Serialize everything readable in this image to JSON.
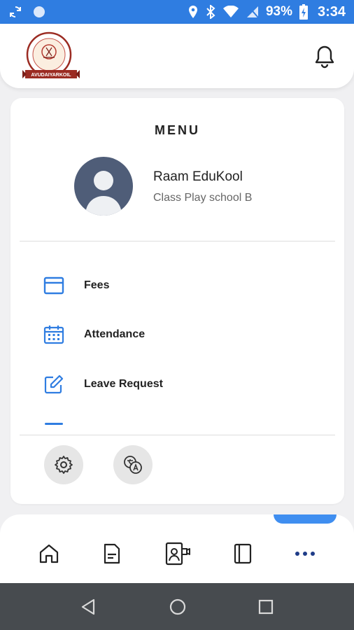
{
  "status_bar": {
    "battery": "93%",
    "time": "3:34"
  },
  "header": {
    "logo_text": "AVUDAIYARKOIL",
    "logo_icon": "school-crest-logo",
    "bell_icon": "bell-icon"
  },
  "menu": {
    "title": "MENU",
    "user": {
      "name": "Raam EduKool",
      "class_name": "Class Play school B"
    },
    "items": [
      {
        "label": "Fees",
        "icon": "credit-card-icon"
      },
      {
        "label": "Attendance",
        "icon": "calendar-icon"
      },
      {
        "label": "Leave Request",
        "icon": "edit-icon"
      }
    ],
    "footer_buttons": [
      {
        "icon": "settings-gear-icon"
      },
      {
        "icon": "translate-icon"
      }
    ]
  },
  "bottom_nav": {
    "items": [
      {
        "icon": "home-icon"
      },
      {
        "icon": "document-icon"
      },
      {
        "icon": "video-contact-icon"
      },
      {
        "icon": "notebook-icon"
      },
      {
        "icon": "more-dots-icon"
      }
    ],
    "active_index": 4
  },
  "colors": {
    "accent": "#2f7de1",
    "status_bar": "#2f7de1",
    "avatar_bg": "#4f5d78",
    "system_nav": "#474b4f"
  }
}
